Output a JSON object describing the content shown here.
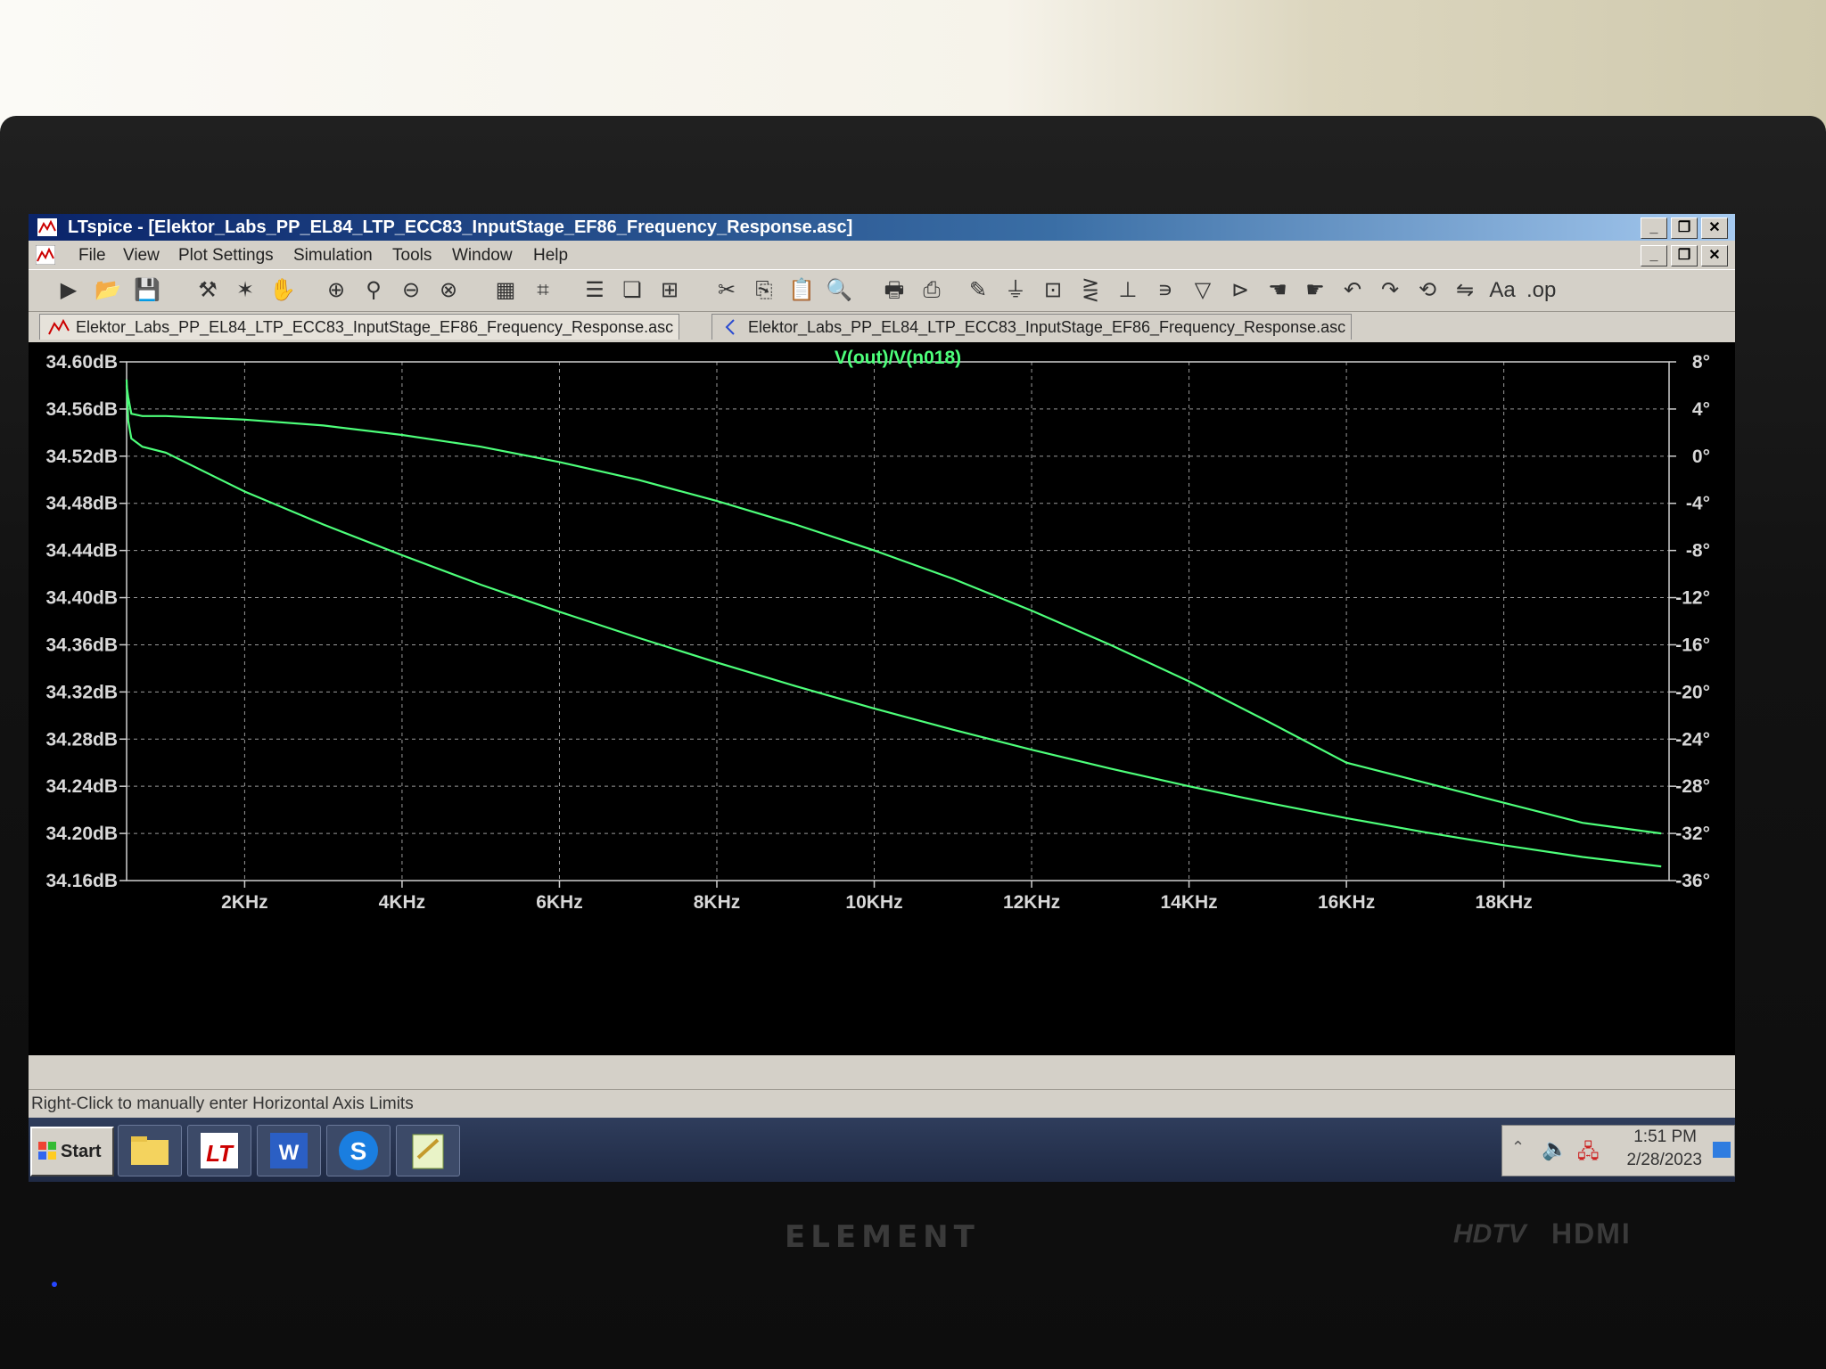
{
  "window": {
    "title": "LTspice - [Elektor_Labs_PP_EL84_LTP_ECC83_InputStage_EF86_Frequency_Response.asc]",
    "controls": [
      "_",
      "❐",
      "✕"
    ]
  },
  "menu": [
    "File",
    "View",
    "Plot Settings",
    "Simulation",
    "Tools",
    "Window",
    "Help"
  ],
  "toolbar_icons": [
    "run-icon",
    "open-icon",
    "save-icon",
    "control-panel-icon",
    "run-simulation-icon",
    "pan-icon",
    "zoom-in-icon",
    "zoom-area-icon",
    "zoom-out-icon",
    "zoom-cancel-icon",
    "autorange-icon",
    "mark-icon",
    "tile-horizontal-icon",
    "cascade-icon",
    "tile-icon",
    "cut-icon",
    "copy-icon",
    "paste-icon",
    "find-icon",
    "print-preview-icon",
    "print-icon",
    "wire-icon",
    "ground-icon",
    "label-icon",
    "resistor-icon",
    "capacitor-icon",
    "inductor-icon",
    "diode-icon",
    "component-icon",
    "move-icon",
    "drag-icon",
    "undo-icon",
    "redo-icon",
    "rotate-icon",
    "mirror-icon",
    "text-icon",
    "spice-directive-icon"
  ],
  "tabs": [
    {
      "label": "Elektor_Labs_PP_EL84_LTP_ECC83_InputStage_EF86_Frequency_Response.asc",
      "active": true
    },
    {
      "label": "Elektor_Labs_PP_EL84_LTP_ECC83_InputStage_EF86_Frequency_Response.asc",
      "active": false
    }
  ],
  "status": "Right-Click to manually enter Horizontal Axis Limits",
  "taskbar": {
    "start": "Start",
    "time": "1:51 PM",
    "date": "2/28/2023"
  },
  "monitor": {
    "brand": "ELEMENT",
    "hdtv": "HDTV",
    "hdmi": "HDMI"
  },
  "chart_data": {
    "type": "line",
    "title": "V(out)/V(n018)",
    "xlabel": "",
    "ylabel": "",
    "xlim": [
      500,
      20100
    ],
    "ylim": [
      34.16,
      34.6
    ],
    "y2lim": [
      -36,
      8
    ],
    "x_ticks": [
      2000,
      4000,
      6000,
      8000,
      10000,
      12000,
      14000,
      16000,
      18000
    ],
    "x_tick_labels": [
      "2KHz",
      "4KHz",
      "6KHz",
      "8KHz",
      "10KHz",
      "12KHz",
      "14KHz",
      "16KHz",
      "18KHz"
    ],
    "y_ticks": [
      "34.60dB",
      "34.56dB",
      "34.52dB",
      "34.48dB",
      "34.44dB",
      "34.40dB",
      "34.36dB",
      "34.32dB",
      "34.28dB",
      "34.24dB",
      "34.20dB",
      "34.16dB"
    ],
    "y2_ticks": [
      "8°",
      "4°",
      "0°",
      "-4°",
      "-8°",
      "-12°",
      "-16°",
      "-20°",
      "-24°",
      "-28°",
      "-32°",
      "-36°"
    ],
    "grid": true,
    "line_color": "#4dff7a",
    "series": [
      {
        "axis": "magnitude",
        "x": [
          500,
          520,
          560,
          700,
          1000,
          2000,
          3000,
          4000,
          5000,
          6000,
          7000,
          8000,
          9000,
          10000,
          11000,
          12000,
          13000,
          14000,
          15000,
          16000,
          17000,
          18000,
          19000,
          20000
        ],
        "values": [
          34.58,
          34.57,
          34.556,
          34.554,
          34.554,
          34.551,
          34.546,
          34.538,
          34.528,
          34.515,
          34.5,
          34.482,
          34.462,
          34.44,
          34.416,
          34.389,
          34.36,
          34.329,
          34.295,
          34.26,
          34.243,
          34.226,
          34.209,
          34.2
        ]
      },
      {
        "axis": "phase",
        "x": [
          500,
          520,
          560,
          700,
          1000,
          2000,
          3000,
          4000,
          5000,
          6000,
          7000,
          8000,
          9000,
          10000,
          11000,
          12000,
          13000,
          14000,
          15000,
          16000,
          17000,
          18000,
          19000,
          20000
        ],
        "values": [
          6.5,
          3.0,
          1.5,
          0.8,
          0.3,
          -3.0,
          -5.8,
          -8.4,
          -10.9,
          -13.2,
          -15.4,
          -17.5,
          -19.5,
          -21.4,
          -23.2,
          -24.9,
          -26.5,
          -28.0,
          -29.4,
          -30.7,
          -31.9,
          -33.0,
          -34.0,
          -34.8
        ]
      }
    ]
  }
}
